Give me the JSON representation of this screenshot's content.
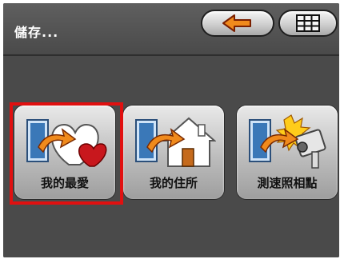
{
  "header": {
    "title": "儲存...",
    "back_icon": "back-arrow-icon",
    "menu_icon": "grid-icon"
  },
  "tiles": [
    {
      "label": "我的最愛",
      "icon": "favorites-heart-icon",
      "selected": true
    },
    {
      "label": "我的住所",
      "icon": "home-icon",
      "selected": false
    },
    {
      "label": "測速照相點",
      "icon": "speed-camera-icon",
      "selected": false
    }
  ],
  "colors": {
    "selection": "#e01010",
    "accent_arrow": "#f08a1c",
    "background": "#4a4a4a"
  }
}
